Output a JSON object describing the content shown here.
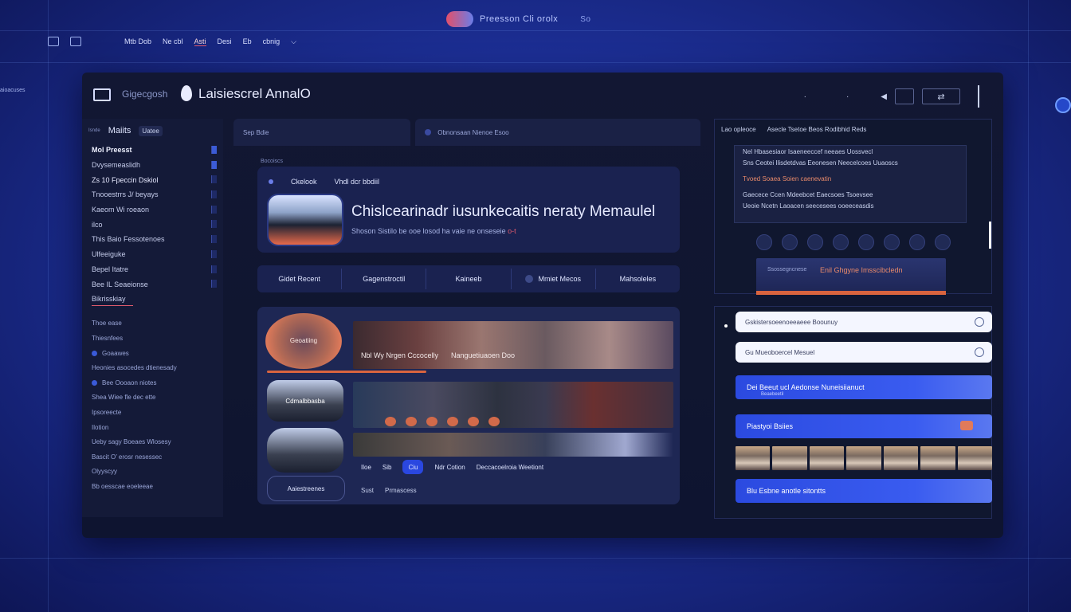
{
  "os": {
    "corner_text": "",
    "brand_title": "Preesson Cli orolx",
    "brand_extra": "So",
    "nav": [
      "Mtb Dob",
      "Ne cbl",
      "Asti",
      "Desi",
      "Eb",
      "cbnig"
    ],
    "left_edge": "aioacuses"
  },
  "window": {
    "sub_label": "Gigecgosh",
    "title": "Laisiescrel AnnalO",
    "tools_label": "⁀"
  },
  "sidebar": {
    "header_small": "Isnde",
    "header": "Maiits",
    "header_pill": "Uatee",
    "items": [
      "Mol Preesst",
      "Dvysemeaslidh",
      "Zs 10 Fpeccin Dskiol",
      "Tnooestrrs J/ beyays",
      "Kaeom Wi roeaon",
      "ilco",
      "This Baio Fessotenoes",
      "Ulfeeiguke",
      "Bepel Itatre",
      "Bee IL Seaeionse",
      "Bikrisskiay"
    ],
    "items2": [
      "Thoe ease",
      "Thiesnfees",
      "Goaawes",
      "Heonies asocedes dtienesady",
      "Bee Oooaon niotes",
      "Shea Wiee fle dec ette",
      "Ipsoreecte",
      "Ilotion",
      "Ueby sagy Boeaes Wlosesy",
      "Bascit O’ erosr nesessec",
      "Olyyscyy",
      "Bb oesscae eoeleeae"
    ]
  },
  "tabs": [
    "Sep Bdie",
    "Obnonsaan Nienoe Esoo"
  ],
  "crumb": "Bocoiscs",
  "feature": {
    "kicker": "Ckelook",
    "kicker2": "Vhdl dcr bbdiil",
    "title": "Chislcearinadr iusunkecaitis neraty Memaulel",
    "subtitle": "Shoson Sistilo be ooe losod ha vaie ne onseseie",
    "subtitle_red": "o-t"
  },
  "filters": [
    "Gidet Recent",
    "Gagenstroctil",
    "Kaineeb",
    "Mmiet Mecos",
    "Mahsoleles"
  ],
  "gallery": {
    "circle_label": "Geoatiing",
    "caption_a": "Nbl Wy Nrgen Cccocelly",
    "caption_b": "Nanguetiuaoen Doo",
    "pill_label": "Cdmalbbasba",
    "row3": [
      "Iloe",
      "Sib",
      "Ciu",
      "Ndr Cotion",
      "Deccacoelroia Weetiont"
    ],
    "row4": [
      "Sust",
      "Prmascess"
    ],
    "pill3": "Aaiestreenes"
  },
  "right": {
    "head": [
      "Lao opleoce",
      "Asecle Tsetoe Beos Rodibhid Reds"
    ],
    "card_lines": [
      "Nel Hbasesiaor  Isaeneeccef  neeaes Uossvecl",
      "Sns Ceotei Ilisdetdvas Eeonesen Neecelcoes Uuaoscs",
      "Tvoed Soaea Soien caenevatin",
      "Gaecece Ccen Mdeebcet Eaecsoes Tsoevsee",
      "Ueoie Ncetn Laoacen seecesees ooeeceasdis"
    ],
    "cta_small": "Ssossegncnese",
    "cta_label": "Enil Ghgyne Imsscibcledn",
    "search_1": "Gskistersoeenoeeaeee Boounuy",
    "search_2": "Gu Mueoboercel Mesuel",
    "btn_1": "Dei Beeut ucl Aedonse Nuneisiianuct",
    "btn_1_small": "Beaebeetil",
    "btn_2": "Piastyoi Bsiies",
    "btn_3": "Blu Esbne anotle sitontts"
  }
}
